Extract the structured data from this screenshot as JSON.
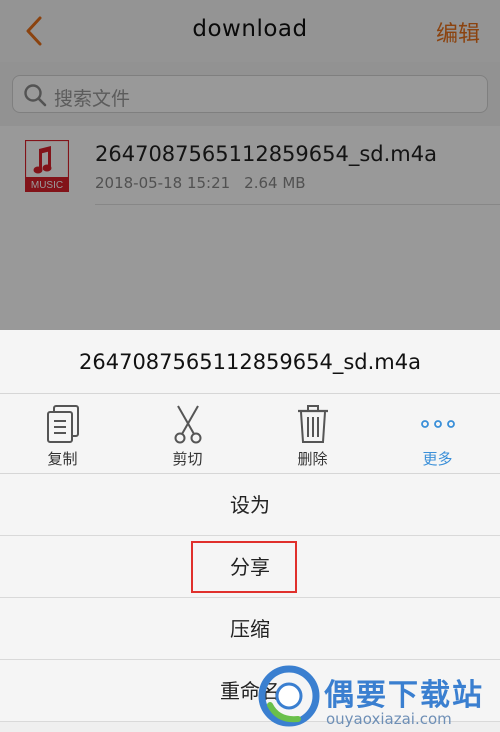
{
  "navbar": {
    "title": "download",
    "edit_label": "编辑",
    "back_icon": "chevron-left-icon",
    "accent": "#e8701a"
  },
  "search": {
    "placeholder": "搜索文件",
    "icon": "search-icon"
  },
  "file": {
    "name": "2647087565112859654_sd.m4a",
    "date": "2018-05-18 15:21",
    "size": "2.64 MB",
    "icon_badge": "MUSIC",
    "icon": "music-file-icon",
    "icon_color": "#d9212b"
  },
  "sheet": {
    "title": "2647087565112859654_sd.m4a",
    "actions": [
      {
        "label": "复制",
        "icon": "copy-icon"
      },
      {
        "label": "剪切",
        "icon": "scissors-icon"
      },
      {
        "label": "删除",
        "icon": "trash-icon"
      },
      {
        "label": "更多",
        "icon": "more-dots-icon"
      }
    ],
    "menu": [
      {
        "label": "设为"
      },
      {
        "label": "分享"
      },
      {
        "label": "压缩"
      },
      {
        "label": "重命名"
      }
    ],
    "more_color": "#3a8fd8",
    "highlight_color": "#e0302c"
  },
  "watermark": {
    "brand": "偶要下载站",
    "url": "ouyaoxiazai.com",
    "color": "#3a7fd0"
  }
}
